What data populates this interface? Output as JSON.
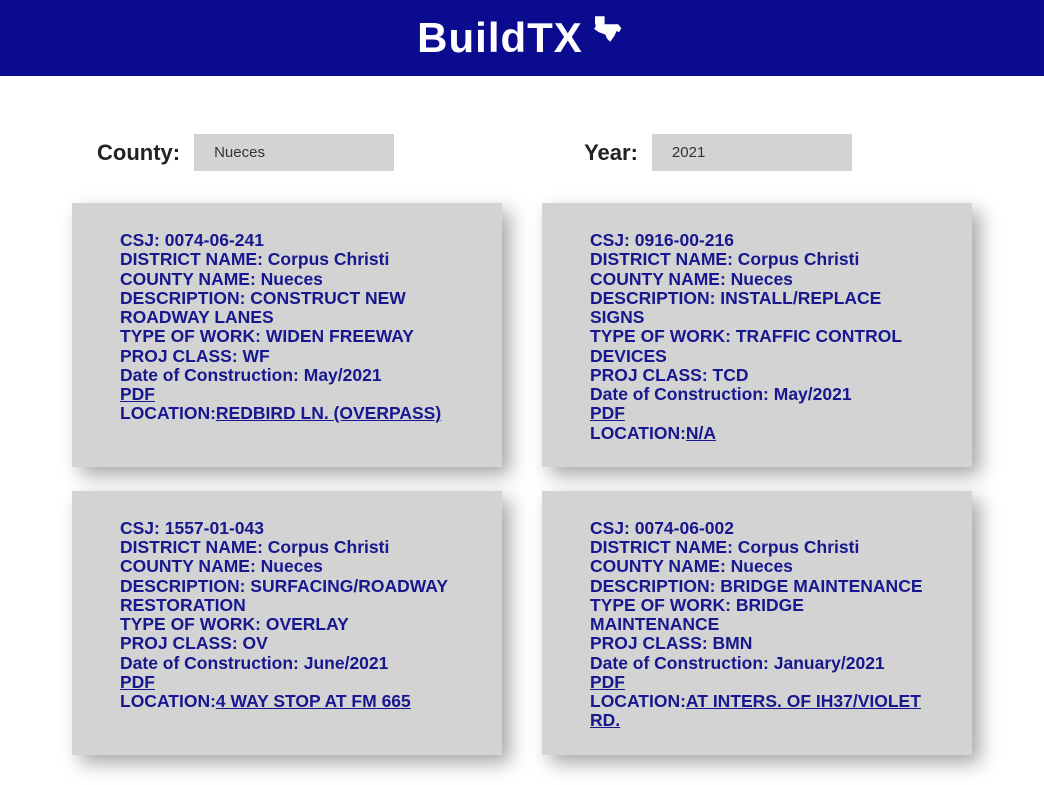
{
  "header": {
    "title": "BuildTX"
  },
  "filters": {
    "county": {
      "label": "County:",
      "value": "Nueces"
    },
    "year": {
      "label": "Year:",
      "value": "2021"
    }
  },
  "labels": {
    "csj": "CSJ: ",
    "district": "DISTRICT NAME: ",
    "county": "COUNTY NAME: ",
    "description": "DESCRIPTION: ",
    "typeofwork": "TYPE OF WORK: ",
    "projclass": "PROJ CLASS: ",
    "date": "Date of Construction: ",
    "pdf": "PDF",
    "location": "LOCATION:"
  },
  "results": [
    {
      "csj": "0074-06-241",
      "district": "Corpus Christi",
      "county": "Nueces",
      "description": "CONSTRUCT NEW ROADWAY LANES",
      "typeofwork": "WIDEN FREEWAY",
      "projclass": "WF",
      "date": "May/2021",
      "location": "REDBIRD LN. (OVERPASS)"
    },
    {
      "csj": "0916-00-216",
      "district": "Corpus Christi",
      "county": "Nueces",
      "description": "INSTALL/REPLACE SIGNS",
      "typeofwork": "TRAFFIC CONTROL DEVICES",
      "projclass": "TCD",
      "date": "May/2021",
      "location": "N/A"
    },
    {
      "csj": "1557-01-043",
      "district": "Corpus Christi",
      "county": "Nueces",
      "description": "SURFACING/ROADWAY RESTORATION",
      "typeofwork": "OVERLAY",
      "projclass": "OV",
      "date": "June/2021",
      "location": "4 WAY STOP AT FM 665"
    },
    {
      "csj": "0074-06-002",
      "district": "Corpus Christi",
      "county": "Nueces",
      "description": "BRIDGE MAINTENANCE",
      "typeofwork": "BRIDGE MAINTENANCE",
      "projclass": "BMN",
      "date": "January/2021",
      "location": "AT INTERS. OF IH37/VIOLET RD."
    }
  ]
}
